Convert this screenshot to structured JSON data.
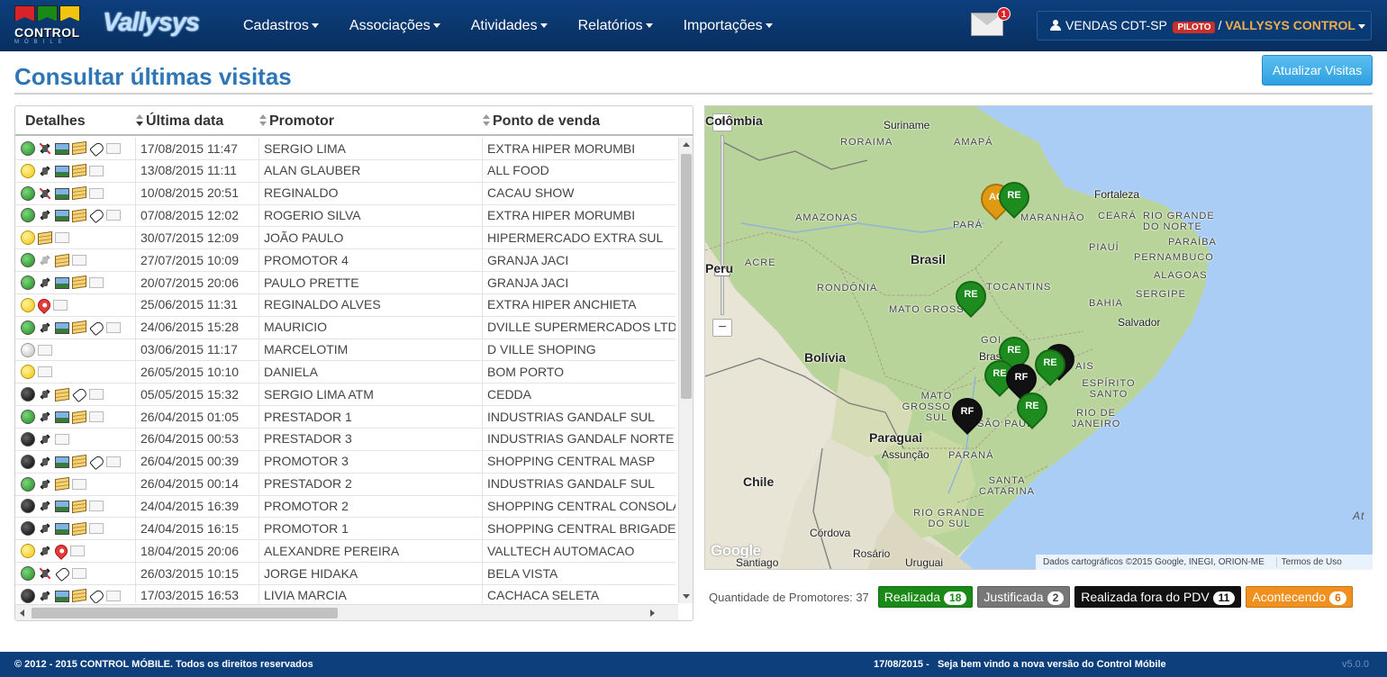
{
  "app": {
    "logo_text": "CONTROL",
    "logo_sub": "MÓBILE",
    "brand": "Vallysys",
    "flag_colors": [
      "#d9232a",
      "#1a8a16",
      "#f1c40f"
    ]
  },
  "nav": {
    "items": [
      {
        "label": "Cadastros"
      },
      {
        "label": "Associações"
      },
      {
        "label": "Atividades"
      },
      {
        "label": "Relatórios"
      },
      {
        "label": "Importações"
      }
    ],
    "mail_count": "1",
    "user": {
      "name": "VENDAS CDT-SP",
      "badge": "PILOTO",
      "separator": "/",
      "company": "VALLYSYS CONTROL"
    }
  },
  "page": {
    "title": "Consultar últimas visitas",
    "update_button": "Atualizar Visitas"
  },
  "table": {
    "headers": {
      "details": "Detalhes",
      "last_date": "Última data",
      "promoter": "Promotor",
      "point_of_sale": "Ponto de venda"
    },
    "rows": [
      {
        "status": "green",
        "icons": [
          "sat-off",
          "img",
          "note",
          "tag",
          "doc"
        ],
        "date": "17/08/2015 11:47",
        "promoter": "SERGIO LIMA",
        "pdv": "EXTRA HIPER MORUMBI"
      },
      {
        "status": "yellow",
        "icons": [
          "sat",
          "img",
          "note",
          "doc"
        ],
        "date": "13/08/2015 11:11",
        "promoter": "ALAN GLAUBER",
        "pdv": "ALL FOOD"
      },
      {
        "status": "green",
        "icons": [
          "sat-off",
          "img",
          "note",
          "doc"
        ],
        "date": "10/08/2015 20:51",
        "promoter": "REGINALDO",
        "pdv": "CACAU SHOW"
      },
      {
        "status": "green",
        "icons": [
          "sat",
          "img",
          "note",
          "tag",
          "doc"
        ],
        "date": "07/08/2015 12:02",
        "promoter": "ROGERIO SILVA",
        "pdv": "EXTRA HIPER MORUMBI"
      },
      {
        "status": "yellow",
        "icons": [
          "note",
          "doc"
        ],
        "date": "30/07/2015 12:09",
        "promoter": "JOÃO PAULO",
        "pdv": "HIPERMERCADO EXTRA SUL"
      },
      {
        "status": "green",
        "icons": [
          "sat-dim",
          "note",
          "doc"
        ],
        "date": "27/07/2015 10:09",
        "promoter": "PROMOTOR 4",
        "pdv": "GRANJA JACI"
      },
      {
        "status": "green",
        "icons": [
          "sat",
          "img",
          "note",
          "doc"
        ],
        "date": "20/07/2015 20:06",
        "promoter": "PAULO PRETTE",
        "pdv": "GRANJA JACI"
      },
      {
        "status": "yellow",
        "icons": [
          "pin",
          "doc"
        ],
        "date": "25/06/2015 11:31",
        "promoter": "REGINALDO ALVES",
        "pdv": "EXTRA HIPER ANCHIETA"
      },
      {
        "status": "green",
        "icons": [
          "sat",
          "img",
          "note",
          "tag",
          "doc"
        ],
        "date": "24/06/2015 15:28",
        "promoter": "MAURICIO",
        "pdv": "DVILLE SUPERMERCADOS LTDA"
      },
      {
        "status": "gray",
        "icons": [
          "doc"
        ],
        "date": "03/06/2015 11:17",
        "promoter": "MARCELOTIM",
        "pdv": "D VILLE SHOPING"
      },
      {
        "status": "yellow",
        "icons": [
          "doc"
        ],
        "date": "26/05/2015 10:10",
        "promoter": "DANIELA",
        "pdv": "BOM PORTO"
      },
      {
        "status": "black",
        "icons": [
          "sat",
          "note",
          "tag",
          "doc"
        ],
        "date": "05/05/2015 15:32",
        "promoter": "SERGIO LIMA ATM",
        "pdv": "CEDDA"
      },
      {
        "status": "green",
        "icons": [
          "sat",
          "img",
          "note",
          "doc"
        ],
        "date": "26/04/2015 01:05",
        "promoter": "PRESTADOR 1",
        "pdv": "INDUSTRIAS GANDALF SUL"
      },
      {
        "status": "black",
        "icons": [
          "sat",
          "doc"
        ],
        "date": "26/04/2015 00:53",
        "promoter": "PRESTADOR 3",
        "pdv": "INDUSTRIAS GANDALF NORTE"
      },
      {
        "status": "black",
        "icons": [
          "sat",
          "img",
          "note",
          "tag",
          "doc"
        ],
        "date": "26/04/2015 00:39",
        "promoter": "PROMOTOR 3",
        "pdv": "SHOPPING CENTRAL MASP"
      },
      {
        "status": "green",
        "icons": [
          "sat",
          "note",
          "doc"
        ],
        "date": "26/04/2015 00:14",
        "promoter": "PRESTADOR 2",
        "pdv": "INDUSTRIAS GANDALF SUL"
      },
      {
        "status": "black",
        "icons": [
          "sat",
          "img",
          "note",
          "doc"
        ],
        "date": "24/04/2015 16:39",
        "promoter": "PROMOTOR 2",
        "pdv": "SHOPPING CENTRAL CONSOLA"
      },
      {
        "status": "black",
        "icons": [
          "sat",
          "img",
          "note",
          "doc"
        ],
        "date": "24/04/2015 16:15",
        "promoter": "PROMOTOR 1",
        "pdv": "SHOPPING CENTRAL BRIGADEII"
      },
      {
        "status": "yellow",
        "icons": [
          "sat",
          "pin",
          "doc"
        ],
        "date": "18/04/2015 20:06",
        "promoter": "ALEXANDRE PEREIRA",
        "pdv": "VALLTECH AUTOMACAO"
      },
      {
        "status": "green",
        "icons": [
          "sat-off",
          "tag",
          "doc"
        ],
        "date": "26/03/2015 10:15",
        "promoter": "JORGE HIDAKA",
        "pdv": "BELA VISTA"
      },
      {
        "status": "black",
        "icons": [
          "sat",
          "img",
          "note",
          "tag",
          "doc"
        ],
        "date": "17/03/2015 16:53",
        "promoter": "LIVIA MARCIA",
        "pdv": "CACHACA SELETA"
      }
    ]
  },
  "map": {
    "labels": {
      "colombia": "Colômbia",
      "suriname": "Suriname",
      "roraima": "RORAIMA",
      "amapa": "AMAPÁ",
      "amazonas": "AMAZONAS",
      "para": "PARÁ",
      "maranhao": "MARANHÃO",
      "fortaleza": "Fortaleza",
      "ceara": "CEARÁ",
      "rio_grande_do_norte": "RIO GRANDE DO NORTE",
      "paraiba": "PARAÍBA",
      "piaui": "PIAUÍ",
      "pernambuco": "PERNAMBUCO",
      "alagoas": "ALAGOAS",
      "sergipe": "SERGIPE",
      "brasil": "Brasil",
      "peru": "Peru",
      "acre": "ACRE",
      "rondonia": "RONDÔNIA",
      "tocantins": "TOCANTINS",
      "bahia": "BAHIA",
      "mato_grosso": "MATO GROSSO",
      "salvador": "Salvador",
      "bolivia": "Bolívia",
      "goias": "GOI",
      "brasilia": "Bras",
      "minas_gerais": "AIS",
      "espirito_santo": "ESPÍRITO SANTO",
      "mato_grosso_do_sul": "MATO GROSSO DO SUL",
      "rio_de_janeiro": "RIO DE JANEIRO",
      "sao_paulo": "SÃO PAUL",
      "paraguai": "Paraguai",
      "assuncao": "Assunção",
      "parana": "PARANÁ",
      "chile": "Chile",
      "santa_catarina": "SANTA CATARINA",
      "rio_grande_do_sul": "RIO GRANDE DO SUL",
      "cordova": "Córdova",
      "rosario": "Rosário",
      "santiago": "Santiago",
      "uruguai": "Uruguai",
      "atlantic": "At"
    },
    "markers": [
      {
        "type": "ac",
        "label": "AC"
      },
      {
        "type": "re",
        "label": "RE"
      },
      {
        "type": "re",
        "label": "RE"
      },
      {
        "type": "re",
        "label": "RE"
      },
      {
        "type": "rf",
        "label": ""
      },
      {
        "type": "re",
        "label": "RE"
      },
      {
        "type": "re",
        "label": "RE"
      },
      {
        "type": "rf",
        "label": "RF"
      },
      {
        "type": "rf",
        "label": "RF"
      },
      {
        "type": "re",
        "label": "RE"
      }
    ],
    "google": "Google",
    "attribution": "Dados cartográficos ©2015 Google, INEGI, ORION-ME",
    "terms": "Termos de Uso",
    "zoom_in": "+",
    "zoom_out": "−"
  },
  "legend": {
    "label": "Quantidade de Promotores: 37",
    "items": [
      {
        "label": "Realizada",
        "count": "18",
        "color": "#1a8a16"
      },
      {
        "label": "Justificada",
        "count": "2",
        "color": "#777777"
      },
      {
        "label": "Realizada fora do PDV",
        "count": "11",
        "color": "#111111"
      },
      {
        "label": "Acontecendo",
        "count": "6",
        "color": "#f0901e"
      }
    ]
  },
  "footer": {
    "copyright": "© 2012 - 2015 CONTROL MÓBILE. Todos os direitos reservados",
    "date": "17/08/2015 -",
    "welcome": "Seja bem vindo a nova versão do Control Móbile",
    "version": "v5.0.0"
  }
}
